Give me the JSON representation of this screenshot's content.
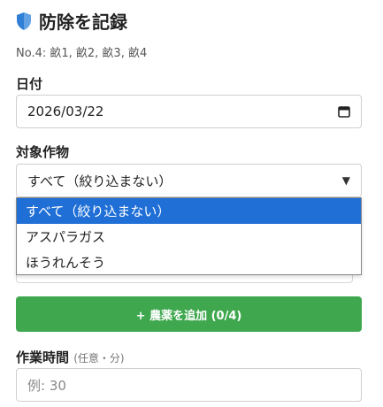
{
  "header": {
    "title": "防除を記録",
    "icon": "shield-icon",
    "icon_color": "#2f7fd6"
  },
  "plots_info": "No.4: 畝1, 畝2, 畝3, 畝4",
  "date_field": {
    "label": "日付",
    "value": "2026/03/22",
    "icon": "calendar-icon"
  },
  "crop_field": {
    "label": "対象作物",
    "value": "すべて（絞り込まない）",
    "options": [
      "すべて（絞り込まない）",
      "アスパラガス",
      "ほうれんそう"
    ],
    "selected_index": 0,
    "highlight_color": "#1f6fd6"
  },
  "add_pesticide_button": {
    "label": "+ 農薬を追加 (0/4)",
    "color": "#3fa84f"
  },
  "work_time_field": {
    "label": "作業時間",
    "hint": "(任意・分)",
    "placeholder": "例: 30"
  }
}
